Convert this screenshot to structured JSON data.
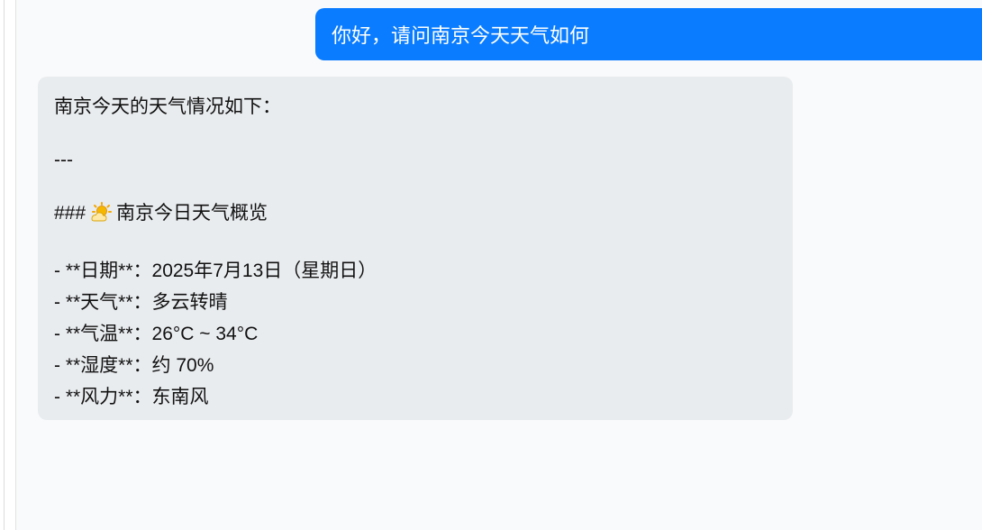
{
  "conversation": {
    "user_message": "你好，请问南京今天天气如何",
    "assistant": {
      "intro": "南京今天的天气情况如下：",
      "divider": "---",
      "heading_prefix": "###",
      "heading_icon": "sun-behind-cloud-icon",
      "heading_text": "南京今日天气概览",
      "items": [
        "- **日期**：2025年7月13日（星期日）",
        "- **天气**：多云转晴",
        "- **气温**：26°C ~ 34°C",
        "- **湿度**：约 70%",
        "- **风力**：东南风"
      ]
    }
  },
  "colors": {
    "user_bubble": "#0a7cff",
    "assistant_bubble": "#e9ecef",
    "chat_background": "#f9fafb"
  }
}
